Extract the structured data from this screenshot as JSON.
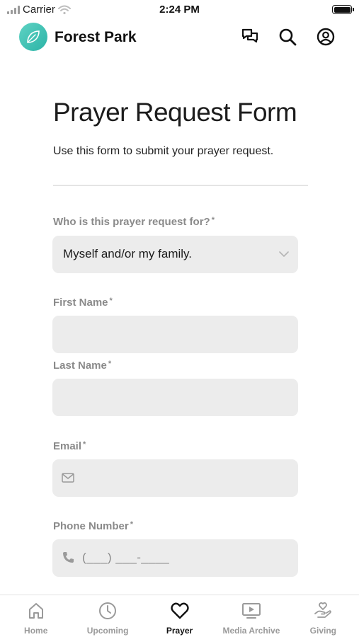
{
  "status_bar": {
    "carrier": "Carrier",
    "time": "2:24 PM"
  },
  "header": {
    "app_title": "Forest Park",
    "icons": [
      "chat-icon",
      "search-icon",
      "profile-icon"
    ]
  },
  "form": {
    "title": "Prayer Request Form",
    "subtitle": "Use this form to submit your prayer request.",
    "fields": {
      "recipient": {
        "label": "Who is this prayer request for?",
        "required_mark": "*",
        "value": "Myself and/or my family."
      },
      "first_name": {
        "label": "First Name",
        "required_mark": "*",
        "value": ""
      },
      "last_name": {
        "label": "Last Name",
        "required_mark": "*",
        "value": ""
      },
      "email": {
        "label": "Email",
        "required_mark": "*",
        "value": ""
      },
      "phone": {
        "label": "Phone Number",
        "required_mark": "*",
        "placeholder": "(___) ___-____"
      }
    }
  },
  "tabs": [
    {
      "label": "Home",
      "icon": "home-icon",
      "active": false
    },
    {
      "label": "Upcoming",
      "icon": "clock-icon",
      "active": false
    },
    {
      "label": "Prayer",
      "icon": "heart-icon",
      "active": true
    },
    {
      "label": "Media Archive",
      "icon": "video-icon",
      "active": false
    },
    {
      "label": "Giving",
      "icon": "giving-hand-icon",
      "active": false
    }
  ],
  "colors": {
    "brand": "#2bb3a6",
    "field_bg": "#ececec",
    "label": "#8a8a8a",
    "active_tab": "#111111",
    "inactive_tab": "#9a9a9a"
  }
}
